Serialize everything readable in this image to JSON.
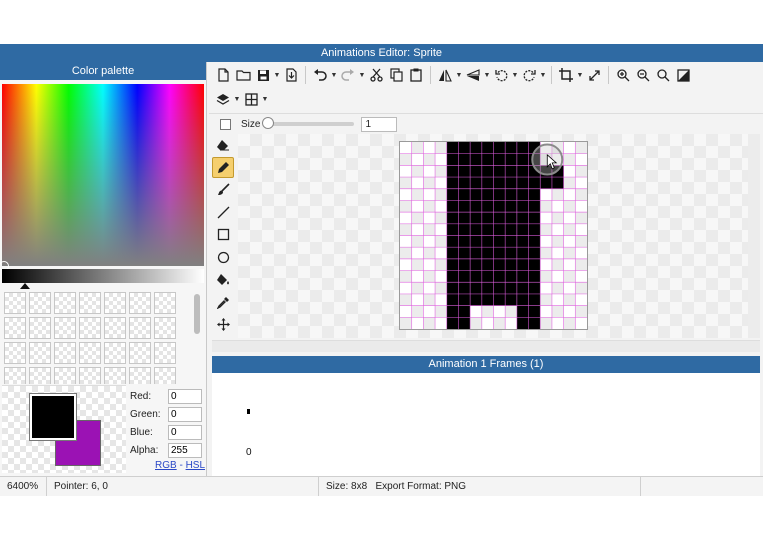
{
  "window": {
    "title": "Animations Editor: Sprite"
  },
  "color_palette": {
    "header": "Color palette",
    "swatch_count": 28,
    "foreground_color": "#000000",
    "background_color": "#9b12b4",
    "channels": [
      {
        "label": "Red:",
        "value": "0"
      },
      {
        "label": "Green:",
        "value": "0"
      },
      {
        "label": "Blue:",
        "value": "0"
      },
      {
        "label": "Alpha:",
        "value": "255"
      }
    ],
    "mode_rgb": "RGB",
    "mode_sep": "-",
    "mode_hsl": "HSL"
  },
  "toolbar": {
    "row1": [
      "new-file-icon",
      "open-folder-icon",
      "save-icon",
      "export-icon",
      "undo-icon",
      "redo-icon",
      "cut-icon",
      "copy-icon",
      "paste-icon",
      "flip-horizontal-icon",
      "flip-vertical-icon",
      "rotate-left-icon",
      "rotate-right-icon",
      "crop-icon",
      "resize-icon",
      "zoom-in-icon",
      "zoom-out-icon",
      "zoom-fit-icon",
      "actual-size-icon"
    ],
    "row2": [
      "layers-icon",
      "grid-icon"
    ]
  },
  "size_bar": {
    "label": "Size",
    "value": "1",
    "slider_level": 0
  },
  "tools": [
    "eraser-icon",
    "pencil-icon",
    "brush-icon",
    "line-icon",
    "rectangle-icon",
    "ellipse-icon",
    "fill-bucket-icon",
    "eyedropper-icon",
    "move-icon"
  ],
  "active_tool": "pencil-icon",
  "sprite": {
    "cols": 8,
    "rows": 8,
    "pixels": [
      "00111100",
      "00111110",
      "00111100",
      "00111100",
      "00111100",
      "00111100",
      "00111100",
      "00100100"
    ]
  },
  "frames_panel": {
    "header": "Animation 1 Frames (1)",
    "frames": [
      "0"
    ]
  },
  "status": {
    "zoom": "6400%",
    "pointer": "Pointer: 6, 0",
    "size": "Size: 8x8",
    "export_format": "Export Format: PNG"
  }
}
